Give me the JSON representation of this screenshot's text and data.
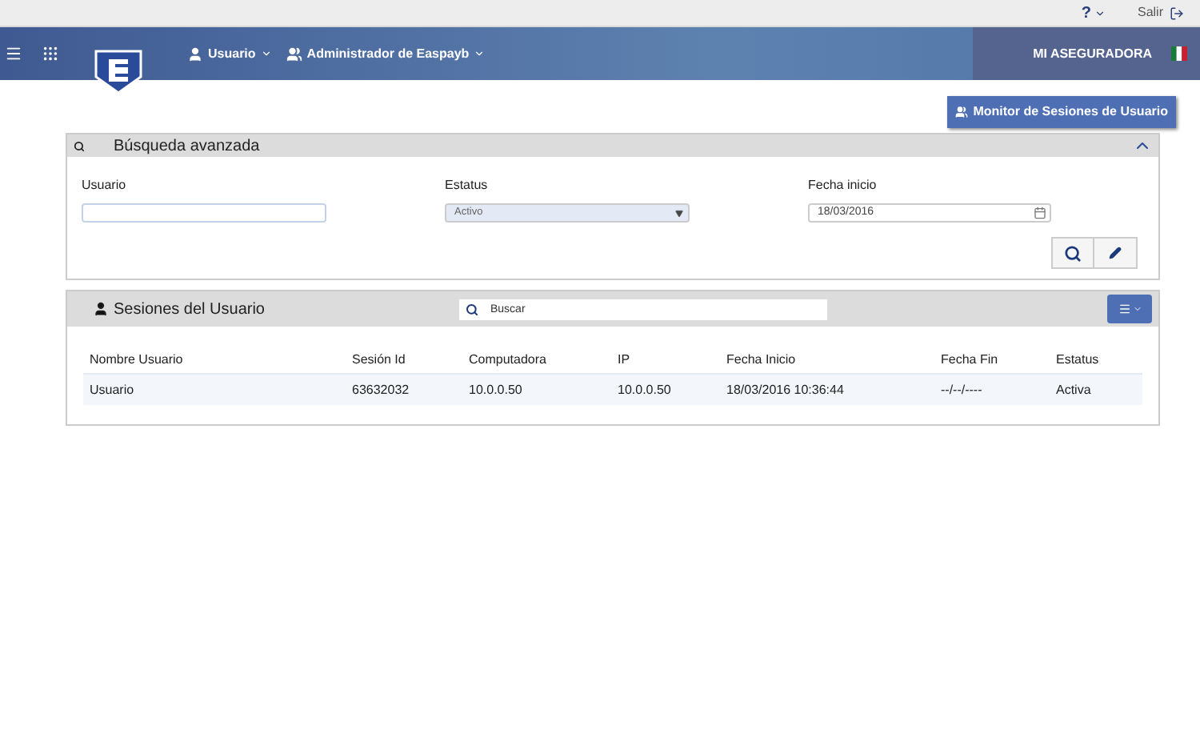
{
  "top_bar": {
    "help": "?",
    "logout": "Salir"
  },
  "header": {
    "menus": [
      {
        "kind": "user",
        "label": "Usuario"
      },
      {
        "kind": "group",
        "label": "Administrador de Easpayb"
      }
    ],
    "company": "MI ASEGURADORA"
  },
  "monitor_button": "Monitor de Sesiones de Usuario",
  "search_panel": {
    "title": "Búsqueda avanzada",
    "expanded": true,
    "fields": [
      {
        "kind": "text",
        "label": "Usuario"
      },
      {
        "kind": "select",
        "label": "Estatus",
        "value": "Activo"
      },
      {
        "kind": "date",
        "label": "Fecha inicio",
        "value": "18/03/2016"
      }
    ]
  },
  "sessions_panel": {
    "title": "Sesiones del Usuario",
    "search": {
      "placeholder": "Buscar"
    },
    "columns": [
      "Nombre Usuario",
      "Sesión Id",
      "Computadora",
      "IP",
      "Fecha Inicio",
      "Fecha Fin",
      "Estatus"
    ],
    "rows": [
      [
        "Usuario",
        "63632032",
        "10.0.0.50",
        "10.0.0.50",
        "18/03/2016 10:36:44",
        "--/--/----",
        "Activa"
      ]
    ]
  }
}
